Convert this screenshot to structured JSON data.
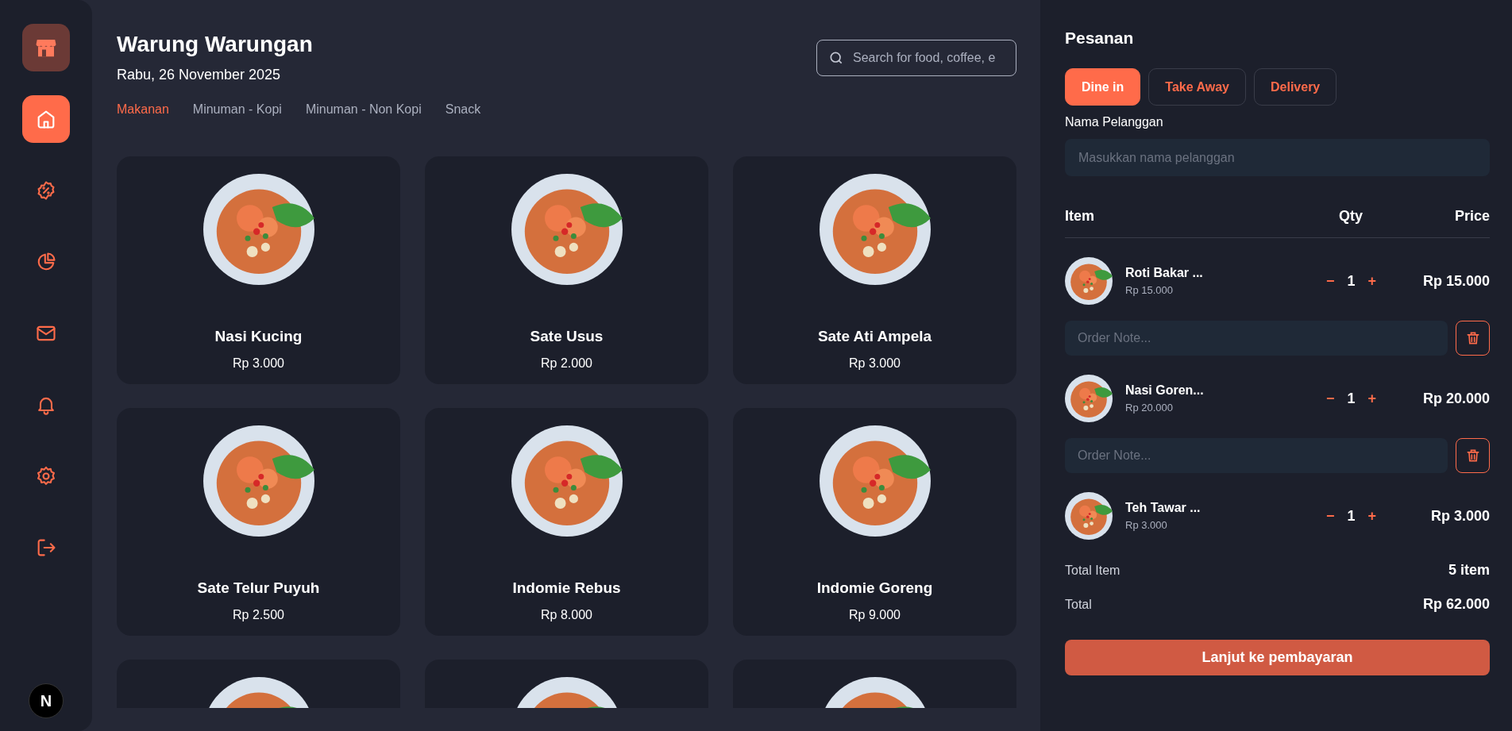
{
  "sidebar": {
    "items": [
      {
        "selected": true
      },
      {
        "selected": false
      },
      {
        "selected": false
      },
      {
        "selected": false
      },
      {
        "selected": false
      },
      {
        "selected": false
      },
      {
        "selected": false
      }
    ],
    "avatar_letter": "N"
  },
  "header": {
    "title": "Warung Warungan",
    "date": "Rabu, 26 November 2025",
    "search": {
      "placeholder": "Search for food, coffee, e"
    }
  },
  "categories": [
    {
      "label": "Makanan",
      "selected": true
    },
    {
      "label": "Minuman - Kopi",
      "selected": false
    },
    {
      "label": "Minuman - Non Kopi",
      "selected": false
    },
    {
      "label": "Snack",
      "selected": false
    }
  ],
  "menu_items": [
    {
      "kind": "dish",
      "name": "Nasi Kucing",
      "price": "Rp 3.000"
    },
    {
      "kind": "dish",
      "name": "Sate Usus",
      "price": "Rp 2.000"
    },
    {
      "kind": "dish",
      "name": "Sate Ati Ampela",
      "price": "Rp 3.000"
    },
    {
      "kind": "dish",
      "name": "Sate Telur Puyuh",
      "price": "Rp 2.500"
    },
    {
      "kind": "dish",
      "name": "Indomie Rebus",
      "price": "Rp 8.000"
    },
    {
      "kind": "dish",
      "name": "Indomie Goreng",
      "price": "Rp 9.000"
    },
    {
      "kind": "cut-off"
    },
    {
      "kind": "cut-off"
    },
    {
      "kind": "cut-off"
    }
  ],
  "order": {
    "title": "Pesanan",
    "order_types": [
      {
        "label": "Dine in",
        "selected": true
      },
      {
        "label": "Take Away",
        "selected": false
      },
      {
        "label": "Delivery",
        "selected": false
      }
    ],
    "customer_label": "Nama Pelanggan",
    "customer_placeholder": "Masukkan nama pelanggan",
    "columns": [
      "Item",
      "Qty",
      "Price"
    ],
    "items": [
      {
        "name": "Roti Bakar ...",
        "unit_price": "Rp 15.000",
        "qty": "1",
        "minus": "−",
        "plus": "+",
        "price": "Rp 15.000",
        "note_placeholder": "Order Note..."
      },
      {
        "name": "Nasi Goren...",
        "unit_price": "Rp 20.000",
        "qty": "1",
        "minus": "−",
        "plus": "+",
        "price": "Rp 20.000",
        "note_placeholder": "Order Note..."
      },
      {
        "name": "Teh Tawar ...",
        "unit_price": "Rp 3.000",
        "qty": "1",
        "minus": "−",
        "plus": "+",
        "price": "Rp 3.000"
      }
    ],
    "summary": [
      {
        "label": "Total Item",
        "value": "5 item"
      },
      {
        "label": "Total",
        "value": "Rp 62.000"
      }
    ],
    "checkout_button": "Lanjut ke pembayaran"
  }
}
